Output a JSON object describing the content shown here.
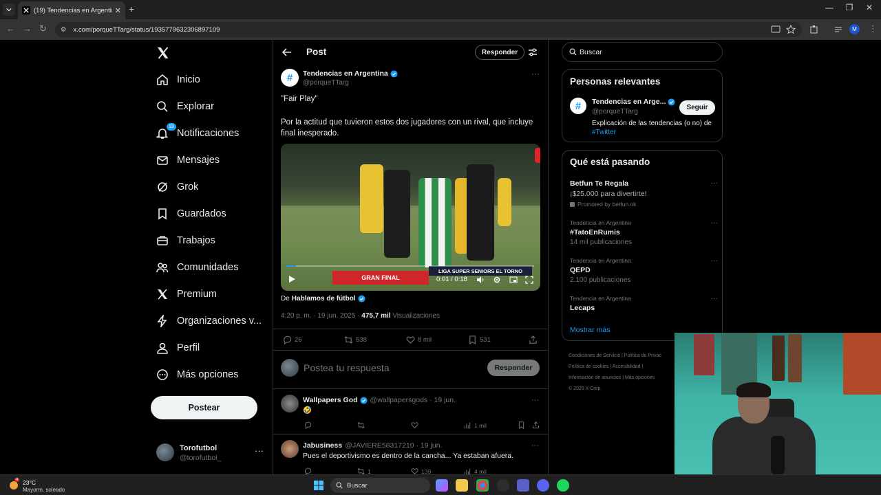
{
  "browser": {
    "tab_title": "(19) Tendencias en Argentina en X",
    "url": "x.com/porqueTTarg/status/1935779632306897109",
    "profile_initial": "M"
  },
  "nav": {
    "items": [
      {
        "label": "Inicio",
        "icon": "home-icon"
      },
      {
        "label": "Explorar",
        "icon": "search-icon"
      },
      {
        "label": "Notificaciones",
        "icon": "bell-icon",
        "badge": "19"
      },
      {
        "label": "Mensajes",
        "icon": "envelope-icon"
      },
      {
        "label": "Grok",
        "icon": "grok-icon"
      },
      {
        "label": "Guardados",
        "icon": "bookmark-icon"
      },
      {
        "label": "Trabajos",
        "icon": "briefcase-icon"
      },
      {
        "label": "Comunidades",
        "icon": "people-icon"
      },
      {
        "label": "Premium",
        "icon": "x-icon"
      },
      {
        "label": "Organizaciones v...",
        "icon": "lightning-icon"
      },
      {
        "label": "Perfil",
        "icon": "person-icon"
      },
      {
        "label": "Más opciones",
        "icon": "more-circle-icon"
      }
    ],
    "post_button": "Postear",
    "account": {
      "name": "Torofutbol",
      "handle": "@torofutbol_"
    }
  },
  "main": {
    "title": "Post",
    "responder_button": "Responder",
    "tweet": {
      "author_name": "Tendencias en Argentina",
      "author_handle": "@porqueTTarg",
      "text1": "\"Fair Play\"",
      "text2": "Por la actitud que tuvieron estos dos jugadores con un rival, que incluye final inesperado.",
      "video": {
        "time": "0:01 / 0:18",
        "banner_left": "GRAN FINAL",
        "banner_right": "LIGA SUPER SENIORS EL TORNO",
        "progress": 0.04
      },
      "from_prefix": "De",
      "from_name": "Hablamos de fútbol",
      "timestamp": "4:20 p. m. · 19 jun. 2025 · ",
      "views_count": "475,7 mil",
      "views_label": " Visualizaciones",
      "stats": {
        "replies": "26",
        "reposts": "538",
        "likes": "8 mil",
        "bookmarks": "531"
      }
    },
    "reply_box": {
      "placeholder": "Postea tu respuesta",
      "button": "Responder"
    },
    "replies": [
      {
        "name": "Wallpapers God",
        "handle": "@wallpapersgods · 19 jun.",
        "text": "🤣",
        "views": "1 mil"
      },
      {
        "name": "Jabusiness",
        "handle": "@JAVIERE58317210 · 19 jun.",
        "text": "Pues el deportivismo es dentro de la cancha... Ya estaban afuera.",
        "reposts": "1",
        "likes": "139",
        "views": "4 mil"
      }
    ]
  },
  "right": {
    "search_placeholder": "Buscar",
    "relevant": {
      "title": "Personas relevantes",
      "name": "Tendencias en Arge...",
      "handle": "@porqueTTarg",
      "bio": "Explicación de las tendencias (o no) de ",
      "bio_link": "#Twitter",
      "follow": "Seguir"
    },
    "trends_title": "Qué está pasando",
    "trends": [
      {
        "context": "",
        "title": "Betfun Te Regala",
        "sub": "¡$25.000 para divertirte!",
        "promo": "Promoted by betfun.ok"
      },
      {
        "context": "Tendencia en Argentina",
        "title": "#TatoEnRumis",
        "sub": "14 mil publicaciones"
      },
      {
        "context": "Tendencia en Argentina",
        "title": "QEPD",
        "sub": "2.100 publicaciones"
      },
      {
        "context": "Tendencia en Argentina",
        "title": "Lecaps",
        "sub": ""
      }
    ],
    "show_more": "Mostrar más",
    "footer": [
      "Condiciones de Servicio | Política de Privac",
      "Política de cookies | Accesibilidad |",
      "Información de anuncios | Más opciones",
      "© 2025 X Corp."
    ]
  },
  "taskbar": {
    "temp": "23°C",
    "weather": "Mayorm. soleado",
    "weather_badge": "4",
    "search": "Buscar"
  }
}
